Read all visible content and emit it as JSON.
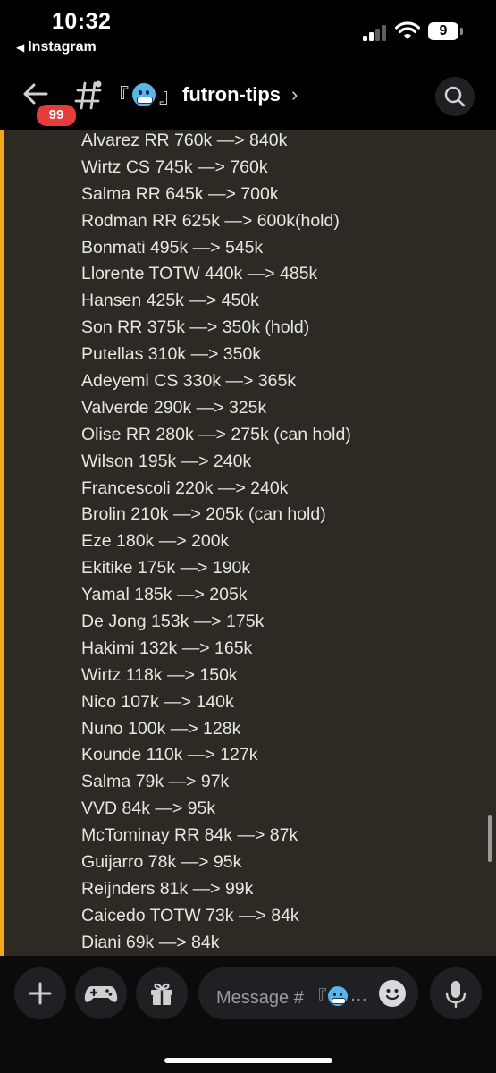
{
  "status_bar": {
    "time": "10:32",
    "back_app_label": "Instagram",
    "back_app_arrow": "◀",
    "battery_level": "9"
  },
  "header": {
    "unread_badge": "99",
    "bracket_open": "『",
    "bracket_close": "』",
    "channel_name": "futron-tips",
    "chevron": "›",
    "emoji_icon": "cold-face-emoji"
  },
  "messages": {
    "lines": [
      "Alvarez RR 760k —> 840k",
      "Wirtz CS 745k —> 760k",
      "Salma RR 645k —> 700k",
      "Rodman RR 625k —> 600k(hold)",
      "Bonmati 495k —> 545k",
      "Llorente TOTW 440k —> 485k",
      "Hansen 425k —> 450k",
      "Son RR 375k —> 350k (hold)",
      "Putellas 310k —> 350k",
      "Adeyemi CS 330k —> 365k",
      "Valverde 290k —> 325k",
      "Olise RR 280k —> 275k (can hold)",
      "Wilson 195k —> 240k",
      "Francescoli 220k —> 240k",
      "Brolin 210k —> 205k (can hold)",
      "Eze 180k —> 200k",
      "Ekitike 175k —> 190k",
      "Yamal 185k —> 205k",
      "De Jong 153k —> 175k",
      "Hakimi 132k —> 165k",
      "Wirtz 118k —> 150k",
      "Nico 107k —> 140k",
      "Nuno 100k —> 128k",
      "Kounde 110k —> 127k",
      "Salma 79k —> 97k",
      "VVD 84k —> 95k",
      "McTominay RR 84k —> 87k",
      "Guijarro 78k —> 95k",
      "Reijnders 81k —> 99k",
      "Caicedo TOTW 73k —> 84k",
      "Diani 69k —> 84k"
    ]
  },
  "composer": {
    "placeholder_prefix": "Message # 『",
    "placeholder_suffix": "…",
    "icons": [
      "plus-icon",
      "gamepad-icon",
      "gift-icon",
      "emoji-smile-icon",
      "microphone-icon"
    ]
  },
  "colors": {
    "background": "#000000",
    "message_bg": "#2c2a23",
    "highlight_stripe": "#f2a81d",
    "badge": "#e53c3c",
    "button_bg": "#1f2023",
    "text": "#e6e6e6",
    "placeholder": "#9a9ba0"
  }
}
